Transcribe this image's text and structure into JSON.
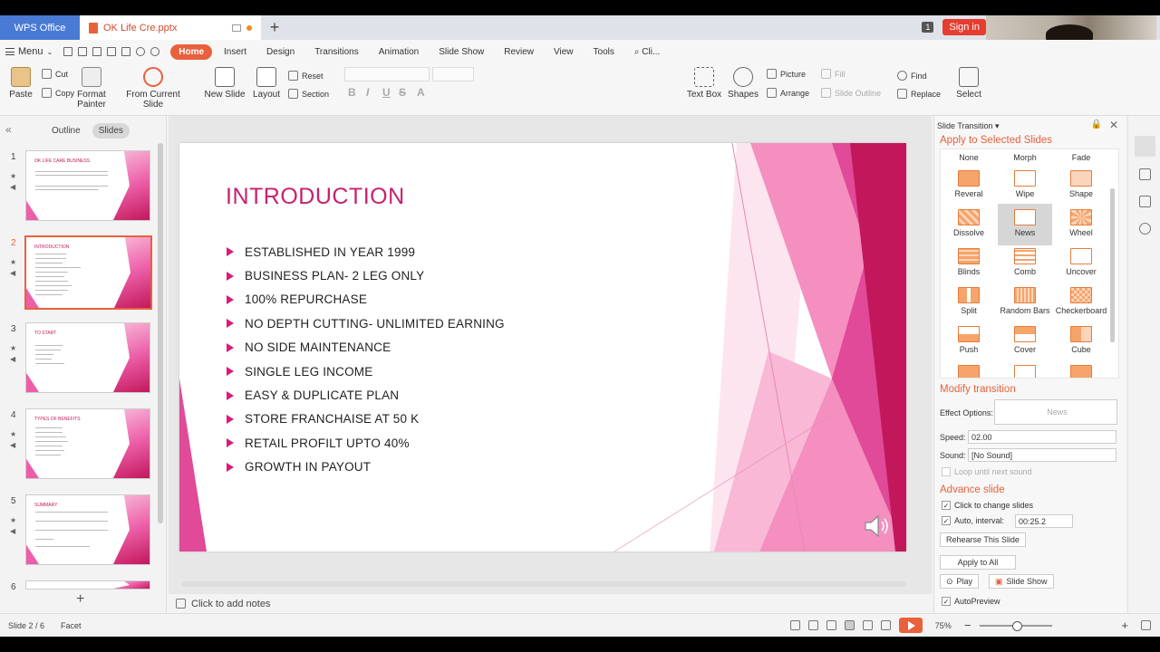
{
  "titlebar": {
    "app_tab": "WPS Office",
    "doc_tab": "OK Life Cre.pptx",
    "window_badge": "1",
    "signin": "Sign in"
  },
  "menubar": {
    "menu_label": "Menu",
    "tabs": [
      "Home",
      "Insert",
      "Design",
      "Transitions",
      "Animation",
      "Slide Show",
      "Review",
      "View",
      "Tools"
    ],
    "search": "Cli..."
  },
  "ribbon": {
    "paste": "Paste",
    "cut": "Cut",
    "copy": "Copy",
    "format_painter_1": "Format",
    "format_painter_2": "Painter",
    "from_current": "From Current Slide",
    "new_slide": "New Slide",
    "layout": "Layout",
    "reset": "Reset",
    "section": "Section",
    "text_box": "Text Box",
    "shapes": "Shapes",
    "picture": "Picture",
    "arrange": "Arrange",
    "fill": "Fill",
    "slide_outline": "Slide Outline",
    "find": "Find",
    "replace": "Replace",
    "select": "Select"
  },
  "leftpanel": {
    "tab_outline": "Outline",
    "tab_slides": "Slides",
    "thumbs": [
      {
        "num": "1",
        "title": "OK LIFE CARE BUSINESS"
      },
      {
        "num": "2",
        "title": "INTRODUCTION"
      },
      {
        "num": "3",
        "title": "TO START"
      },
      {
        "num": "4",
        "title": "TYPES OF BENEFITS"
      },
      {
        "num": "5",
        "title": "SUMMARY"
      },
      {
        "num": "6",
        "title": ""
      }
    ]
  },
  "slide": {
    "title": "INTRODUCTION",
    "bullets": [
      "ESTABLISHED IN YEAR 1999",
      "BUSINESS PLAN- 2 LEG ONLY",
      "100% REPURCHASE",
      "NO DEPTH CUTTING- UNLIMITED EARNING",
      "NO SIDE MAINTENANCE",
      "SINGLE LEG INCOME",
      "EASY & DUPLICATE PLAN",
      "STORE FRANCHAISE AT 50 K",
      "RETAIL PROFILT UPTO 40%",
      "GROWTH IN PAYOUT"
    ]
  },
  "notes": {
    "placeholder": "Click to add notes"
  },
  "rpanel": {
    "title": "Slide Transition",
    "apply_selected": "Apply to Selected Slides",
    "transitions": [
      "None",
      "Morph",
      "Fade",
      "Reveral",
      "Wipe",
      "Shape",
      "Dissolve",
      "News",
      "Wheel",
      "Blinds",
      "Comb",
      "Uncover",
      "Split",
      "Random Bars",
      "Checkerboard",
      "Push",
      "Cover",
      "Cube"
    ],
    "selected_transition": "News",
    "modify": "Modify transition",
    "effect_options_label": "Effect Options:",
    "effect_options_value": "News",
    "speed_label": "Speed:",
    "speed_value": "02.00",
    "sound_label": "Sound:",
    "sound_value": "[No Sound]",
    "loop": "Loop until next sound",
    "advance": "Advance slide",
    "click_change": "Click to change slides",
    "auto_label": "Auto, interval:",
    "auto_value": "00:25.2",
    "rehearse": "Rehearse This Slide",
    "apply_all": "Apply to All",
    "play": "Play",
    "slide_show": "Slide Show",
    "autopreview": "AutoPreview"
  },
  "status": {
    "slide_info": "Slide 2 / 6",
    "theme": "Facet",
    "zoom": "75%"
  }
}
